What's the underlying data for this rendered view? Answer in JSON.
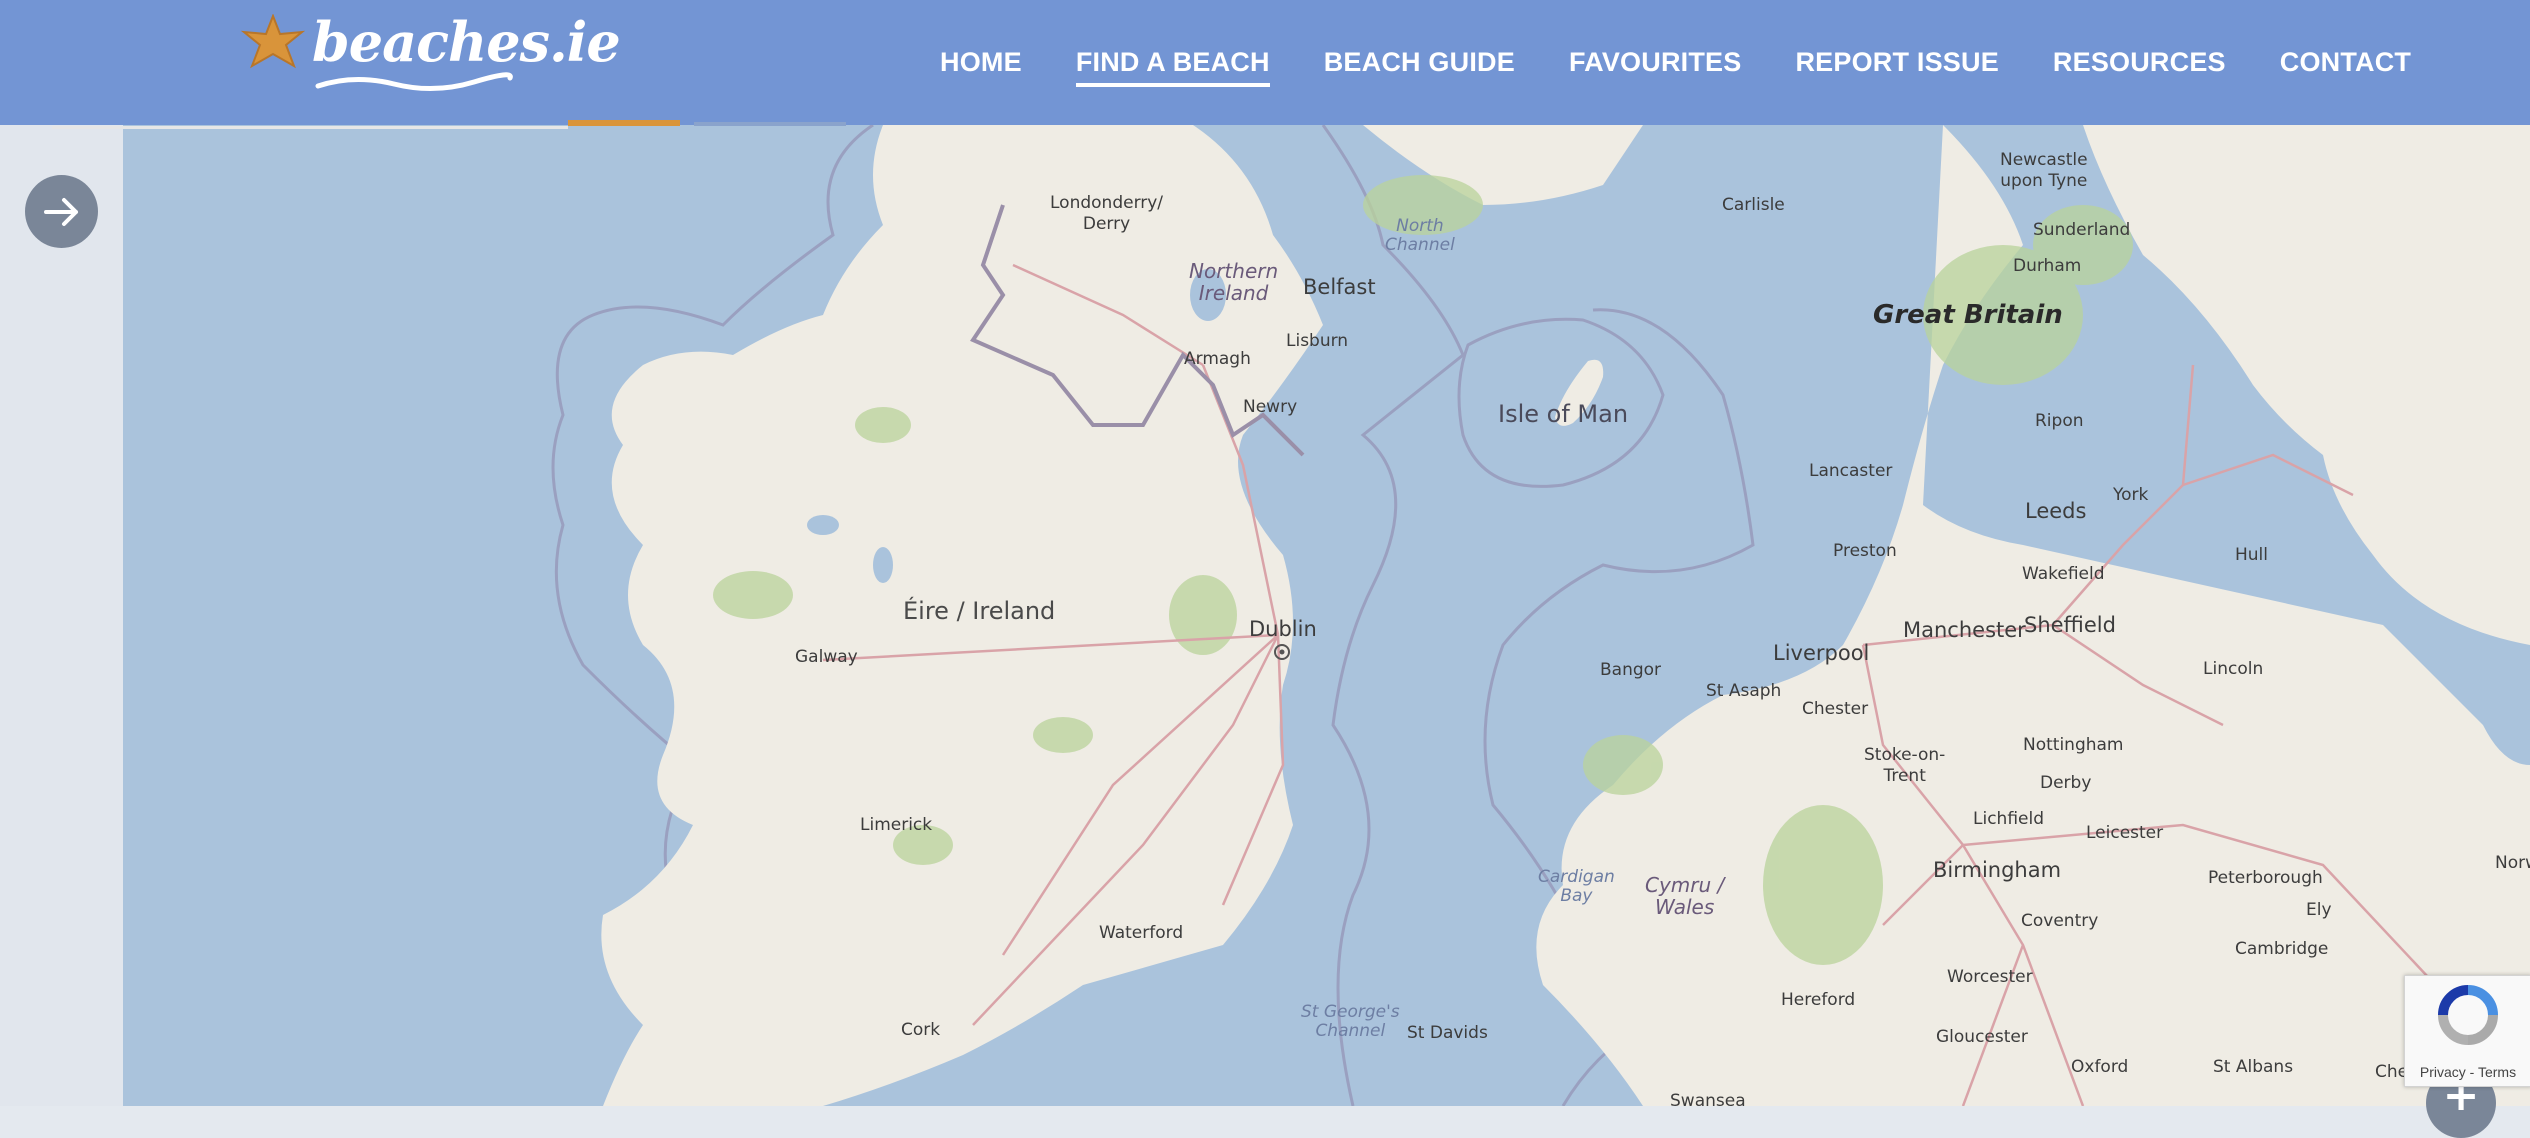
{
  "brand": {
    "logo_text": "beaches.ie"
  },
  "nav": {
    "items": [
      "HOME",
      "FIND A BEACH",
      "BEACH GUIDE",
      "FAVOURITES",
      "REPORT ISSUE",
      "RESOURCES",
      "CONTACT"
    ],
    "active_item": "FIND A BEACH"
  },
  "map": {
    "countries": [
      "Éire / Ireland",
      "Great Britain"
    ],
    "islands": [
      "Isle of Man"
    ],
    "seas": [
      "North\nChannel",
      "St George's\nChannel",
      "Cardigan\nBay"
    ],
    "regions": [
      "Northern\nIreland",
      "Cymru /\nWales"
    ],
    "cities_ireland": [
      "Londonderry/\nDerry",
      "Belfast",
      "Lisburn",
      "Armagh",
      "Newry",
      "Dublin",
      "Galway",
      "Limerick",
      "Waterford",
      "Cork"
    ],
    "cities_gb": [
      "Newcastle\nupon Tyne",
      "Carlisle",
      "Sunderland",
      "Durham",
      "Ripon",
      "Lancaster",
      "York",
      "Leeds",
      "Preston",
      "Wakefield",
      "Hull",
      "Manchester",
      "Sheffield",
      "Liverpool",
      "Bangor",
      "St Asaph",
      "Chester",
      "Lincoln",
      "Stoke-on-\nTrent",
      "Nottingham",
      "Derby",
      "Lichfield",
      "Leicester",
      "Birmingham",
      "Peterborough",
      "Ely",
      "Coventry",
      "Cambridge",
      "Worcester",
      "Hereford",
      "Gloucester",
      "St Davids",
      "Oxford",
      "St Albans",
      "Chelmsf",
      "Norw",
      "Swansea"
    ]
  },
  "recaptcha": {
    "privacy": "Privacy",
    "separator": " - ",
    "terms": "Terms"
  },
  "controls": {
    "zoom_in": "+",
    "expand_icon": "arrow-right-icon"
  },
  "colors": {
    "header": "#7395d4",
    "sea": "#aac3dc",
    "land": "#f2efe9",
    "accent": "#d9943a"
  }
}
